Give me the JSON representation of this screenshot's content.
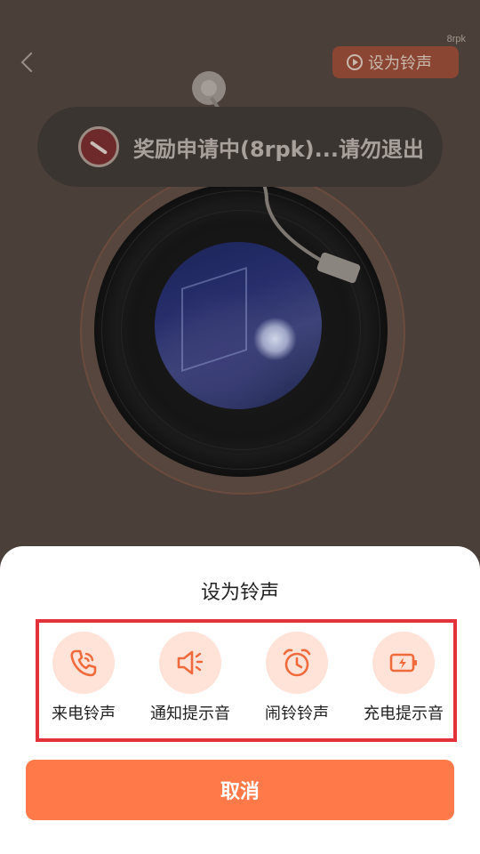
{
  "header": {
    "tag": "8rpk",
    "set_ringtone_label": "设为铃声"
  },
  "toast": {
    "message": "奖励申请中(8rpk)...请勿退出"
  },
  "sheet": {
    "title": "设为铃声",
    "options": [
      {
        "label": "来电铃声",
        "icon": "phone-icon"
      },
      {
        "label": "通知提示音",
        "icon": "speaker-icon"
      },
      {
        "label": "闹铃铃声",
        "icon": "alarm-clock-icon"
      },
      {
        "label": "充电提示音",
        "icon": "battery-charging-icon"
      }
    ],
    "cancel_label": "取消"
  },
  "colors": {
    "accent": "#ff7a48",
    "icon": "#f06a3c",
    "icon_bg": "#ffe3d8",
    "highlight_border": "#e3323c"
  }
}
